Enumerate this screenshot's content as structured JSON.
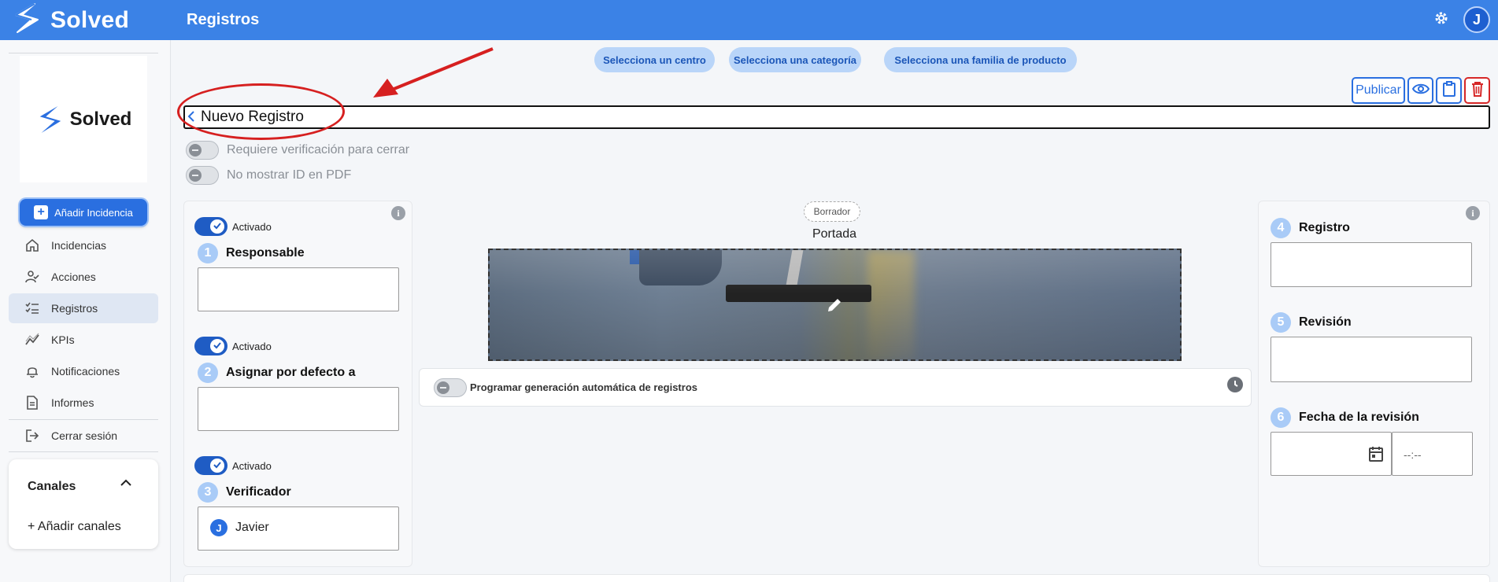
{
  "app": {
    "brand": "Solved",
    "page_title": "Registros",
    "user_initial": "J"
  },
  "sidebar": {
    "logo_text": "Solved",
    "add_button": "Añadir Incidencia",
    "items": [
      {
        "label": "Incidencias",
        "icon": "home-icon"
      },
      {
        "label": "Acciones",
        "icon": "user-check-icon"
      },
      {
        "label": "Registros",
        "icon": "checklist-icon",
        "active": true
      },
      {
        "label": "KPIs",
        "icon": "chart-line-icon"
      },
      {
        "label": "Notificaciones",
        "icon": "bell-icon"
      },
      {
        "label": "Informes",
        "icon": "document-icon"
      },
      {
        "label": "Cerrar sesión",
        "icon": "logout-icon"
      }
    ],
    "channels": {
      "title": "Canales",
      "add": "+ Añadir canales"
    }
  },
  "filters": [
    "Selecciona un centro",
    "Selecciona una categoría",
    "Selecciona una familia de producto"
  ],
  "actions": {
    "publish": "Publicar"
  },
  "record": {
    "title": "Nuevo Registro",
    "require_verification": "Requiere verificación para cerrar",
    "hide_id_pdf": "No mostrar ID en PDF"
  },
  "left_panel": {
    "activated": "Activado",
    "steps": [
      {
        "num": "1",
        "label": "Responsable",
        "value": ""
      },
      {
        "num": "2",
        "label": "Asignar por defecto a",
        "value": ""
      },
      {
        "num": "3",
        "label": "Verificador",
        "value": "Javier",
        "user_initial": "J"
      }
    ]
  },
  "center_panel": {
    "status": "Borrador",
    "cover_label": "Portada",
    "schedule": "Programar generación automática de registros"
  },
  "right_panel": {
    "steps": [
      {
        "num": "4",
        "label": "Registro"
      },
      {
        "num": "5",
        "label": "Revisión"
      },
      {
        "num": "6",
        "label": "Fecha de la revisión"
      }
    ],
    "time_placeholder": "--:--"
  },
  "colors": {
    "brand": "#3b82e6",
    "accent": "#2a6fe0",
    "danger": "#d62828",
    "annotation": "#d62020"
  }
}
